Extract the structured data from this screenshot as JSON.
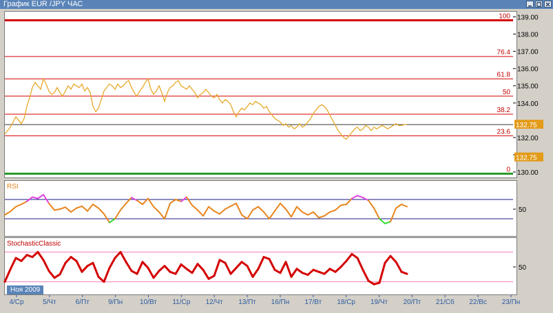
{
  "window": {
    "title": "График EUR /JPY  ЧАС"
  },
  "date_tag": "Ноя 2009",
  "colors": {
    "price": "#e7a92a",
    "fib": "#d40000",
    "rsi": "#e8841c",
    "rsi_over": "#e040e0",
    "rsi_under": "#33dd33",
    "stoch": "#d40000",
    "stoch_lines": "#f07ab8",
    "rsi_lines": "#1a1a80"
  },
  "chart_data": [
    {
      "type": "line",
      "title": "График EUR /JPY  ЧАС",
      "ylim": [
        129.6,
        139.3
      ],
      "y_ticks": [
        "139.00",
        "138.00",
        "137.00",
        "136.00",
        "135.00",
        "134.00",
        "132.00",
        "131.00",
        "130.00"
      ],
      "current_price": "132.75",
      "fib_levels": [
        {
          "label": "100",
          "value": 138.8
        },
        {
          "label": "76.4",
          "value": 136.7
        },
        {
          "label": "61.8",
          "value": 135.4
        },
        {
          "label": "50",
          "value": 134.4
        },
        {
          "label": "38.2",
          "value": 133.35
        },
        {
          "label": "23.6",
          "value": 132.1
        },
        {
          "label": "0",
          "value": 129.9
        }
      ],
      "x": [
        0,
        4,
        8,
        12,
        16,
        20,
        24,
        28,
        32,
        36,
        40,
        44,
        48,
        52,
        56,
        60,
        64,
        68,
        72,
        76,
        80,
        84,
        88,
        92,
        96,
        100,
        104,
        108,
        112,
        116,
        120,
        124,
        128,
        132,
        136,
        140,
        144,
        148,
        152,
        156,
        160,
        164,
        168,
        172,
        176,
        180,
        184,
        188,
        192,
        196,
        200,
        204,
        208,
        212,
        216,
        220,
        224,
        228,
        232,
        236,
        240,
        244,
        248,
        252,
        256,
        260,
        264,
        268,
        272,
        276,
        280,
        284,
        288,
        292,
        296,
        300,
        304,
        308,
        312,
        316,
        320,
        324,
        328,
        332,
        336,
        340,
        344,
        348,
        352,
        356,
        360,
        364,
        368,
        372,
        376,
        380,
        384,
        388,
        392,
        396,
        400,
        404,
        408,
        412,
        416,
        420,
        424,
        428,
        432,
        436,
        440,
        444,
        448,
        452,
        456,
        460,
        464,
        468,
        472,
        476,
        480,
        484,
        488,
        492,
        496,
        500,
        504,
        508,
        512,
        516,
        520,
        524,
        528,
        532,
        536,
        540,
        544,
        548,
        552,
        556,
        560,
        564,
        568,
        572,
        576,
        580,
        584
      ],
      "series": [
        {
          "values": [
            132.2,
            132.4,
            132.6,
            132.9,
            133.2,
            133.0,
            132.8,
            133.1,
            133.8,
            134.3,
            134.9,
            135.2,
            135.0,
            134.8,
            135.4,
            135.1,
            134.7,
            134.5,
            134.6,
            134.9,
            134.6,
            134.4,
            134.7,
            135.0,
            134.8,
            135.1,
            135.0,
            134.9,
            135.1,
            134.7,
            134.9,
            134.6,
            133.8,
            133.5,
            133.7,
            134.2,
            134.7,
            134.9,
            135.1,
            135.0,
            134.8,
            135.1,
            134.9,
            135.0,
            135.2,
            135.3,
            134.9,
            134.6,
            134.4,
            134.7,
            134.9,
            135.2,
            135.4,
            134.8,
            134.5,
            134.7,
            135.0,
            134.6,
            134.1,
            134.6,
            134.9,
            135.0,
            135.2,
            135.3,
            135.0,
            134.9,
            134.8,
            135.0,
            134.8,
            134.6,
            134.3,
            134.5,
            134.6,
            134.8,
            134.6,
            134.4,
            134.3,
            134.5,
            134.2,
            134.0,
            134.2,
            134.1,
            133.9,
            133.5,
            133.2,
            133.5,
            133.7,
            133.6,
            133.8,
            134.0,
            133.9,
            134.1,
            134.0,
            133.9,
            133.7,
            133.8,
            133.5,
            133.3,
            133.1,
            133.0,
            132.9,
            132.7,
            132.8,
            132.6,
            132.7,
            132.5,
            132.6,
            132.8,
            132.6,
            132.7,
            132.9,
            133.1,
            133.4,
            133.6,
            133.8,
            133.9,
            133.8,
            133.6,
            133.3,
            133.0,
            132.7,
            132.4,
            132.2,
            132.0,
            131.9,
            132.1,
            132.3,
            132.5,
            132.6,
            132.4,
            132.5,
            132.7,
            132.6,
            132.4,
            132.6,
            132.5,
            132.6,
            132.7,
            132.6,
            132.5,
            132.6,
            132.7,
            132.8,
            132.7,
            132.7,
            132.75,
            132.75
          ]
        }
      ]
    },
    {
      "type": "line",
      "title": "RSI",
      "ylim": [
        0,
        100
      ],
      "y_ticks": [
        "50"
      ],
      "levels": [
        70,
        30
      ],
      "x": [
        0,
        8,
        16,
        24,
        32,
        40,
        48,
        56,
        64,
        72,
        80,
        88,
        96,
        104,
        112,
        120,
        128,
        136,
        144,
        152,
        160,
        168,
        176,
        184,
        192,
        200,
        208,
        216,
        224,
        232,
        240,
        248,
        256,
        264,
        272,
        280,
        288,
        296,
        304,
        312,
        320,
        328,
        336,
        344,
        352,
        360,
        368,
        376,
        384,
        392,
        400,
        408,
        416,
        424,
        432,
        440,
        448,
        456,
        464,
        472,
        480,
        488,
        496,
        504,
        512,
        520,
        528,
        536,
        544,
        552,
        560,
        568,
        576,
        584
      ],
      "series": [
        {
          "values": [
            38,
            45,
            55,
            60,
            66,
            75,
            72,
            80,
            62,
            48,
            50,
            54,
            44,
            52,
            56,
            46,
            60,
            52,
            40,
            22,
            30,
            48,
            62,
            74,
            68,
            60,
            72,
            55,
            44,
            30,
            62,
            70,
            66,
            75,
            58,
            48,
            36,
            55,
            46,
            40,
            50,
            56,
            62,
            38,
            30,
            48,
            55,
            44,
            30,
            46,
            62,
            50,
            34,
            55,
            44,
            38,
            44,
            32,
            36,
            44,
            48,
            58,
            60,
            72,
            78,
            74,
            68,
            52,
            30,
            20,
            24,
            52,
            60,
            55
          ]
        }
      ]
    },
    {
      "type": "line",
      "title": "StochasticClassic",
      "ylim": [
        0,
        100
      ],
      "y_ticks": [
        "50"
      ],
      "levels": [
        80,
        20
      ],
      "x": [
        0,
        8,
        16,
        24,
        32,
        40,
        48,
        56,
        64,
        72,
        80,
        88,
        96,
        104,
        112,
        120,
        128,
        136,
        144,
        152,
        160,
        168,
        176,
        184,
        192,
        200,
        208,
        216,
        224,
        232,
        240,
        248,
        256,
        264,
        272,
        280,
        288,
        296,
        304,
        312,
        320,
        328,
        336,
        344,
        352,
        360,
        368,
        376,
        384,
        392,
        400,
        408,
        416,
        424,
        432,
        440,
        448,
        456,
        464,
        472,
        480,
        488,
        496,
        504,
        512,
        520,
        528,
        536,
        544,
        552,
        560,
        568,
        576,
        584
      ],
      "series": [
        {
          "values": [
            20,
            45,
            68,
            62,
            74,
            70,
            80,
            64,
            42,
            28,
            35,
            58,
            70,
            62,
            40,
            52,
            58,
            30,
            20,
            48,
            68,
            80,
            60,
            42,
            36,
            60,
            48,
            28,
            42,
            52,
            40,
            36,
            55,
            46,
            38,
            56,
            44,
            26,
            32,
            64,
            58,
            36,
            48,
            60,
            52,
            30,
            46,
            70,
            66,
            44,
            38,
            60,
            30,
            46,
            38,
            34,
            44,
            40,
            36,
            46,
            40,
            50,
            62,
            76,
            68,
            44,
            22,
            15,
            18,
            58,
            72,
            60,
            40,
            36
          ]
        }
      ]
    }
  ],
  "x_axis": [
    "4/Ср",
    "5/Чт",
    "6/Пт",
    "9/Пн",
    "10/Вт",
    "11/Ср",
    "12/Чт",
    "13/Пт",
    "16/Пн",
    "17/Вт",
    "18/Ср",
    "19/Чт",
    "20/Пт",
    "21/Сб",
    "22/Вс",
    "23/Пн"
  ]
}
